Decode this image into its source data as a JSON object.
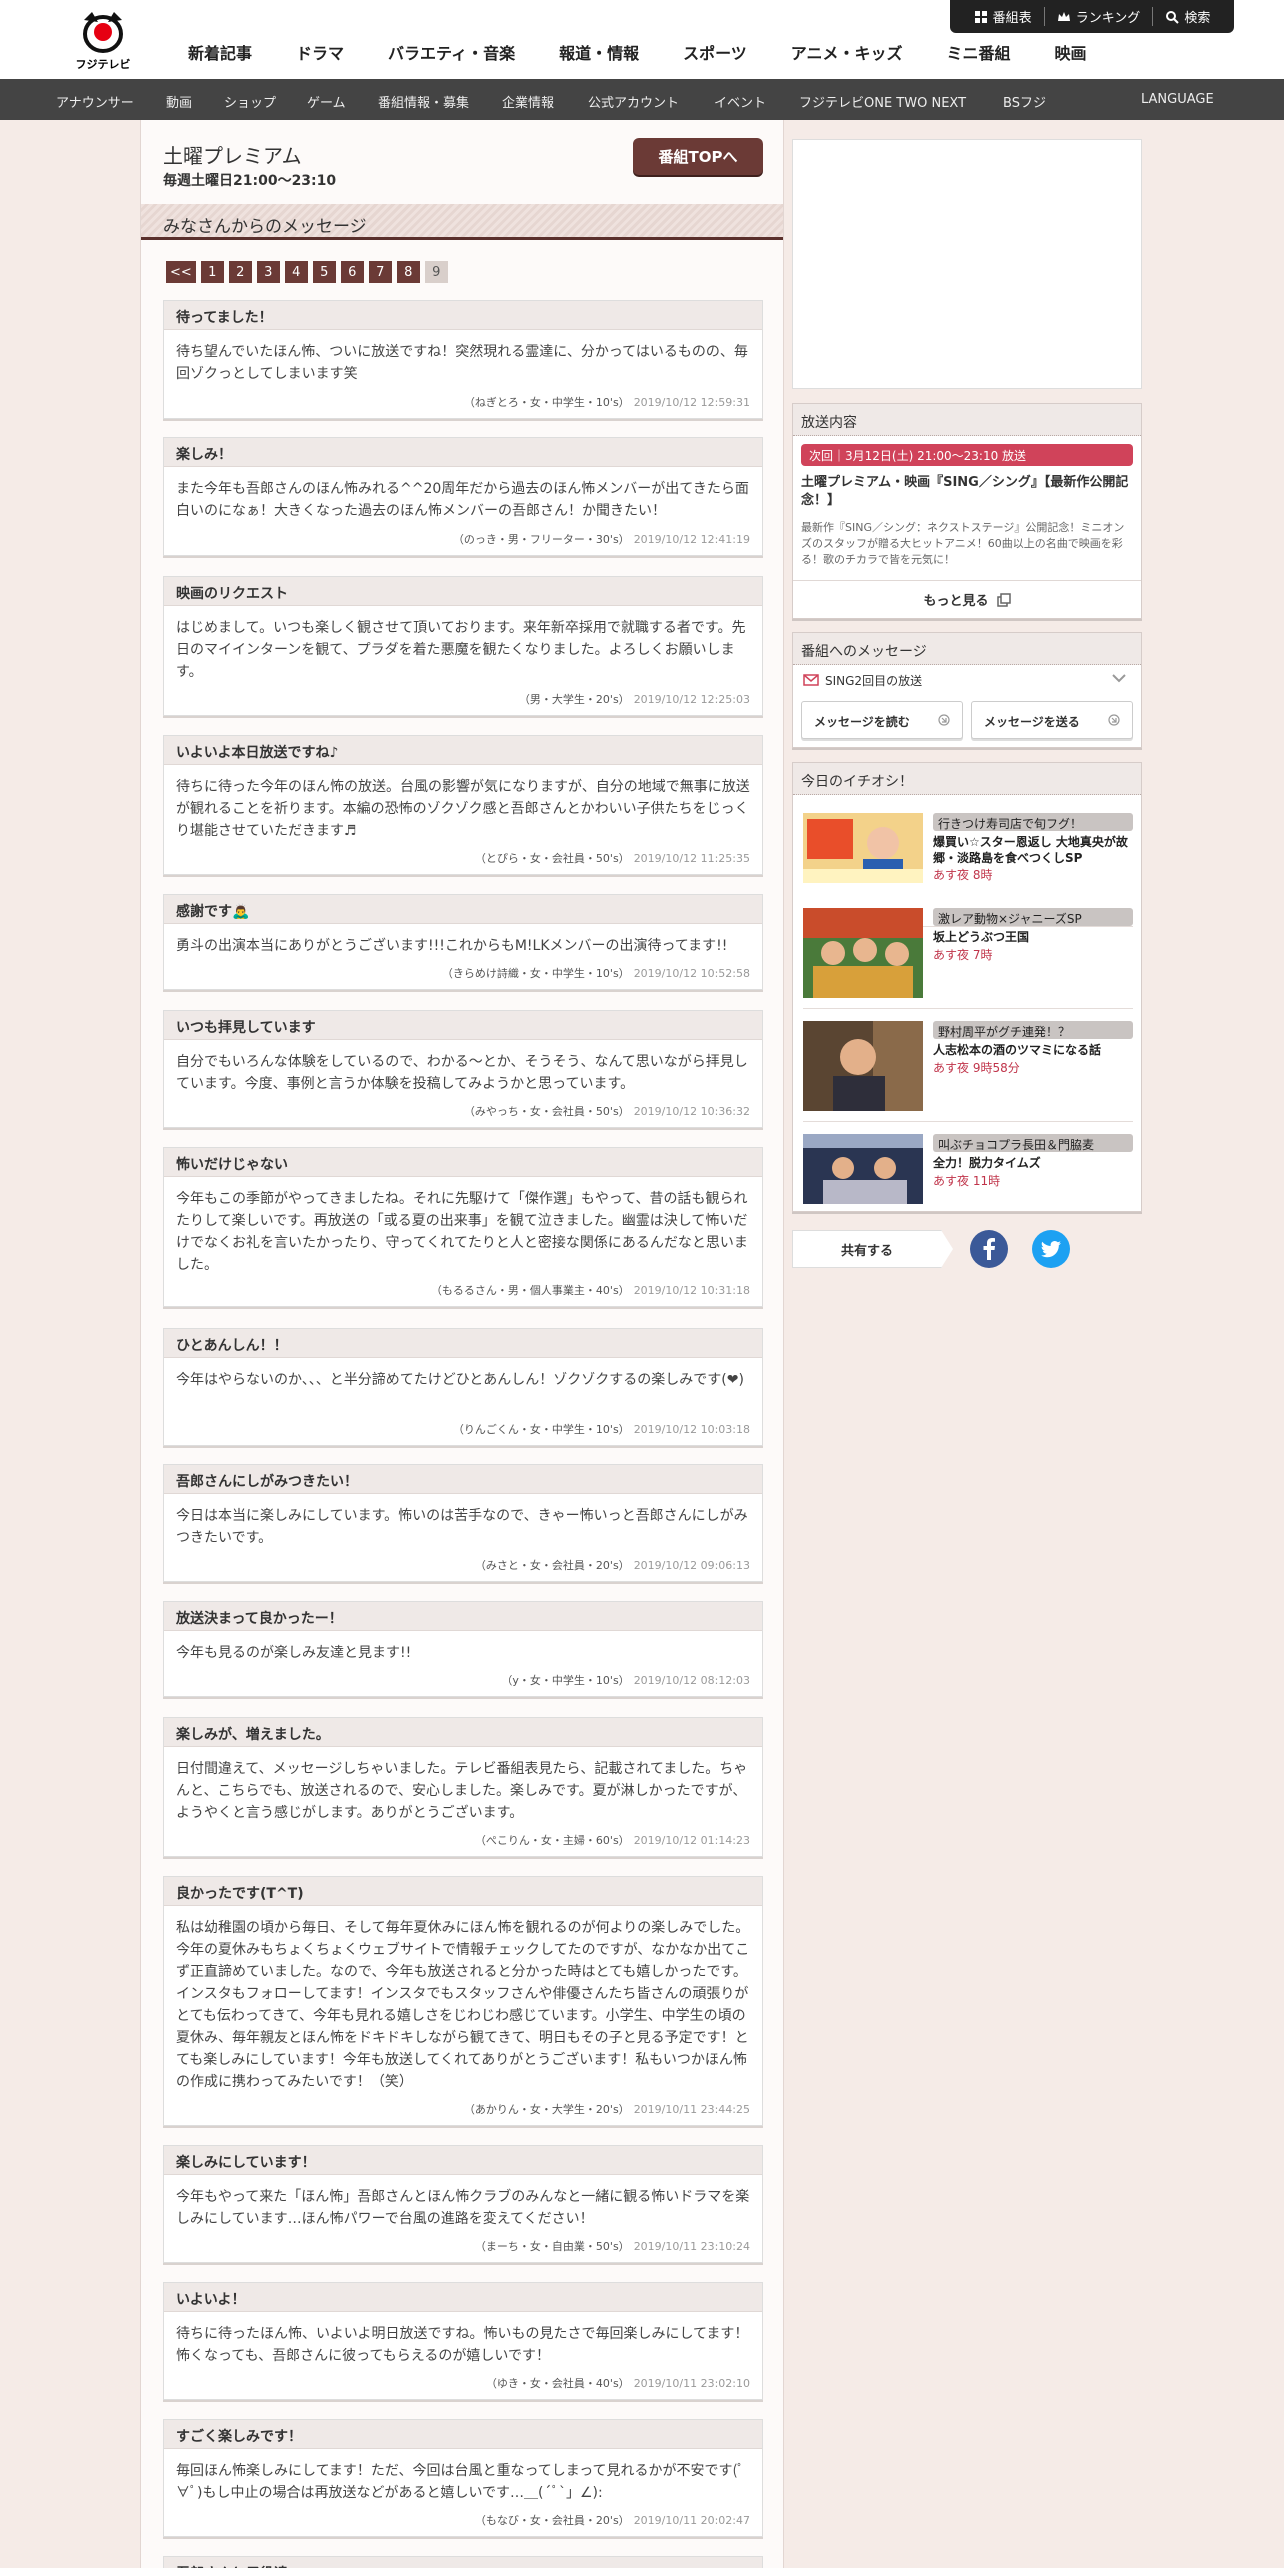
{
  "header": {
    "logo_text": "フジテレビ",
    "main_nav": [
      "新着記事",
      "ドラマ",
      "バラエティ・音楽",
      "報道・情報",
      "スポーツ",
      "アニメ・キッズ",
      "ミニ番組",
      "映画"
    ],
    "util": [
      "番組表",
      "ランキング",
      "検索"
    ],
    "sub_nav": [
      "アナウンサー",
      "動画",
      "ショップ",
      "ゲーム",
      "番組情報・募集",
      "企業情報",
      "公式アカウント",
      "イベント",
      "フジテレビONE TWO NEXT",
      "BSフジ",
      "LANGUAGE"
    ]
  },
  "program": {
    "title": "土曜プレミアム",
    "time": "毎週土曜日21:00～23:10",
    "top_button": "番組TOPへ"
  },
  "section_title": "みなさんからのメッセージ",
  "pager": {
    "prev": "<<",
    "pages": [
      "1",
      "2",
      "3",
      "4",
      "5",
      "6",
      "7",
      "8",
      "9"
    ],
    "current": "9"
  },
  "messages": [
    {
      "title": "待ってました！",
      "body": "待ち望んでいたほん怖、ついに放送ですね！突然現れる霊達に、分かってはいるものの、毎回ゾクっとしてしまいます笑",
      "author": "（ねぎとろ・女・中学生・10's）",
      "date": "2019/10/12 12:59:31"
    },
    {
      "title": "楽しみ！",
      "body": "また今年も吾郎さんのほん怖みれる^^20周年だから過去のほん怖メンバーが出てきたら面白いのになぁ！大きくなった過去のほん怖メンバーの吾郎さん！か聞きたい！",
      "author": "（のっき・男・フリーター・30's）",
      "date": "2019/10/12 12:41:19"
    },
    {
      "title": "映画のリクエスト",
      "body": "はじめまして。いつも楽しく観させて頂いております。来年新卒採用で就職する者です。先日のマイインターンを観て、プラダを着た悪魔を観たくなりました。よろしくお願いします。",
      "author": "（男・大学生・20's）",
      "date": "2019/10/12 12:25:03"
    },
    {
      "title": "いよいよ本日放送ですね♪",
      "body": "待ちに待った今年のほん怖の放送。台風の影響が気になりますが、自分の地域で無事に放送が観れることを祈ります。本編の恐怖のゾクゾク感と吾郎さんとかわいい子供たちをじっくり堪能させていただきます♬",
      "author": "（とぴら・女・会社員・50's）",
      "date": "2019/10/12 11:25:35"
    },
    {
      "title": "感謝です🙇‍♂️",
      "body": "勇斗の出演本当にありがとうございます!!!これからもM!LKメンバーの出演待ってます!!",
      "author": "（きらめけ詩織・女・中学生・10's）",
      "date": "2019/10/12 10:52:58"
    },
    {
      "title": "いつも拝見しています",
      "body": "自分でもいろんな体験をしているので、わかる～とか、そうそう、なんて思いながら拝見しています。今度、事例と言うか体験を投稿してみようかと思っています。",
      "author": "（みやっち・女・会社員・50's）",
      "date": "2019/10/12 10:36:32"
    },
    {
      "title": "怖いだけじゃない",
      "body": "今年もこの季節がやってきましたね。それに先駆けて「傑作選」もやって、昔の話も観られたりして楽しいです。再放送の「或る夏の出来事」を観て泣きました。幽霊は決して怖いだけでなくお礼を言いたかったり、守ってくれてたりと人と密接な関係にあるんだなと思いました。",
      "author": "（もるるさん・男・個人事業主・40's）",
      "date": "2019/10/12 10:31:18"
    },
    {
      "title": "ひとあんしん！！",
      "body": "今年はやらないのか、、、と半分諦めてたけどひとあんしん！ゾクゾクするの楽しみです(❤︎)",
      "author": "（りんごくん・女・中学生・10's）",
      "date": "2019/10/12 10:03:18"
    },
    {
      "title": "吾郎さんにしがみつきたい！",
      "body": "今日は本当に楽しみにしています。怖いのは苦手なので、きゃー怖いっと吾郎さんにしがみつきたいです。",
      "author": "（みさと・女・会社員・20's）",
      "date": "2019/10/12 09:06:13"
    },
    {
      "title": "放送決まって良かったー！",
      "body": "今年も見るのが楽しみ友達と見ます!!",
      "author": "（y・女・中学生・10's）",
      "date": "2019/10/12 08:12:03"
    },
    {
      "title": "楽しみが、増えました。",
      "body": "日付間違えて、メッセージしちゃいました。テレビ番組表見たら、記載されてました。ちゃんと、こちらでも、放送されるので、安心しました。楽しみです。夏が淋しかったですが、ようやくと言う感じがします。ありがとうございます。",
      "author": "（ぺこりん・女・主婦・60's）",
      "date": "2019/10/12 01:14:23"
    },
    {
      "title": "良かったです(T^T)",
      "body": "私は幼稚園の頃から毎日、そして毎年夏休みにほん怖を観れるのが何よりの楽しみでした。今年の夏休みもちょくちょくウェブサイトで情報チェックしてたのですが、なかなか出てこず正直諦めていました。なので、今年も放送されると分かった時はとても嬉しかったです。インスタもフォローしてます！インスタでもスタッフさんや俳優さんたち皆さんの頑張りがとても伝わってきて、今年も見れる嬉しさをじわじわ感じています。小学生、中学生の頃の夏休み、毎年親友とほん怖をドキドキしながら観てきて、明日もその子と見る予定です！とても楽しみにしています！今年も放送してくれてありがとうございます！私もいつかほん怖の作成に携わってみたいです！（笑）",
      "author": "（あかりん・女・大学生・20's）",
      "date": "2019/10/11 23:44:25"
    },
    {
      "title": "楽しみにしています！",
      "body": "今年もやって来た「ほん怖」吾郎さんとほん怖クラブのみんなと一緒に観る怖いドラマを楽しみにしています…ほん怖パワーで台風の進路を変えてください！",
      "author": "（まーち・女・自由業・50's）",
      "date": "2019/10/11 23:10:24"
    },
    {
      "title": "いよいよ！",
      "body": "待ちに待ったほん怖、いよいよ明日放送ですね。怖いもの見たさで毎回楽しみにしてます！怖くなっても、吾郎さんに彼ってもらえるのが嬉しいです！",
      "author": "（ゆき・女・会社員・40's）",
      "date": "2019/10/11 23:02:10"
    },
    {
      "title": "すごく楽しみです！",
      "body": "毎回ほん怖楽しみにしてます！ただ、今回は台風と重なってしまって見れるかが不安です(ﾟ∀ﾟ)もし中止の場合は再放送などがあると嬉しいです…＿(´ﾟ`」∠):",
      "author": "（もなび・女・会社員・20's）",
      "date": "2019/10/11 20:02:47"
    },
    {
      "title": "吾郎さんと子役達",
      "body": "",
      "author": "",
      "date": ""
    }
  ],
  "broadcast": {
    "head": "放送内容",
    "next": "次回｜3月12日(土) 21:00～23:10 放送",
    "title": "土曜プレミアム・映画『SING／シング』【最新作公開記念！】",
    "desc": "最新作『SING／シング：ネクストステージ』公開記念！ミニオンズのスタッフが贈る大ヒットアニメ！60曲以上の名曲で映画を彩る！歌のチカラで皆を元気に！",
    "more": "もっと見る"
  },
  "message_panel": {
    "head": "番組へのメッセージ",
    "selected": "SING2回目の放送",
    "read": "メッセージを読む",
    "send": "メッセージを送る"
  },
  "picks": {
    "head": "今日のイチオシ！",
    "items": [
      {
        "tag": "行きつけ寿司店で旬フグ！",
        "title": "爆買い☆スター恩返し 大地真央が故郷・淡路島を食べつくしSP",
        "time": "あす夜 8時"
      },
      {
        "tag": "激レア動物×ジャニーズSP",
        "title": "坂上どうぶつ王国",
        "time": "あす夜 7時"
      },
      {
        "tag": "野村周平がグチ連発！？",
        "title": "人志松本の酒のツマミになる話",
        "time": "あす夜 9時58分"
      },
      {
        "tag": "叫ぶチョコプラ長田＆門脇麦",
        "title": "全力！脱力タイムズ",
        "time": "あす夜 11時"
      }
    ]
  },
  "share": {
    "label": "共有する"
  },
  "colors": {
    "accent": "#6b3a36",
    "badge": "#d0435a",
    "facebook": "#3b5998",
    "twitter": "#1da1f2"
  }
}
